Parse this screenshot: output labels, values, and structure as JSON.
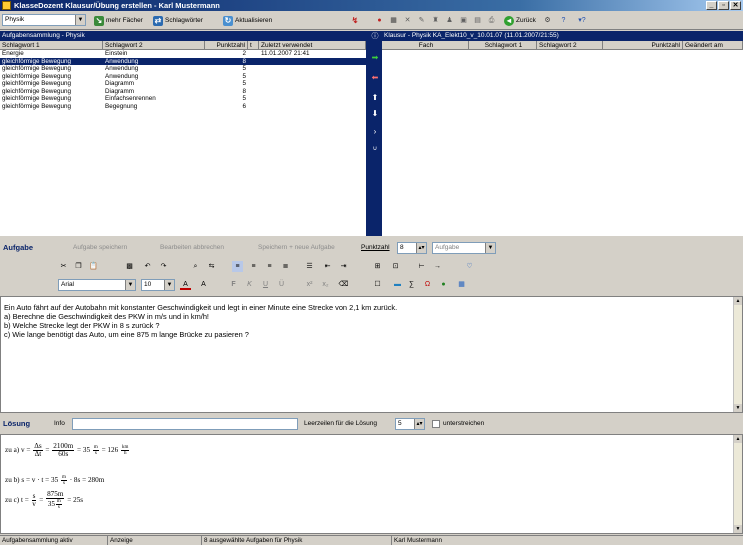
{
  "window": {
    "title": "KlasseDozent Klausur/Übung erstellen - Karl Mustermann",
    "min": "_",
    "max": "▫",
    "close": "✕"
  },
  "toolbar_left": {
    "subject": "Physik",
    "more_subjects": "mehr Fächer",
    "keywords": "Schlagwörter",
    "refresh": "Aktualisieren"
  },
  "toolbar_right": {
    "back": "Zurück",
    "help_mark": "?",
    "search_mark": "▾?"
  },
  "left_panel": {
    "header": "Aufgabensammlung - Physik",
    "columns": [
      "Schlagwort 1",
      "Schlagwort 2",
      "Punktzahl",
      "t",
      "Zuletzt verwendet"
    ],
    "rows": [
      [
        "Energie",
        "Einstein",
        "2",
        "",
        "11.01.2007 21:41"
      ],
      [
        "gleichförmige Bewegung",
        "Anwendung",
        "8",
        "",
        ""
      ],
      [
        "gleichförmige Bewegung",
        "Anwendung",
        "5",
        "",
        ""
      ],
      [
        "gleichförmige Bewegung",
        "Anwendung",
        "5",
        "",
        ""
      ],
      [
        "gleichförmige Bewegung",
        "Diagramm",
        "5",
        "",
        ""
      ],
      [
        "gleichförmige Bewegung",
        "Diagramm",
        "8",
        "",
        ""
      ],
      [
        "gleichförmige Bewegung",
        "Einfachsenrennen",
        "5",
        "",
        ""
      ],
      [
        "gleichförmige Bewegung",
        "Begegnung",
        "6",
        "",
        ""
      ]
    ],
    "selected_row": 1
  },
  "right_panel": {
    "header": "Klausur - Physik KA_Elekt10_v_10.01.07 (11.01.2007/21:55)",
    "columns": [
      "Fach",
      "Schlagwort 1",
      "Schlagwort 2",
      "Punktzahl",
      "Geändert am"
    ]
  },
  "task_bar": {
    "title": "Aufgabe",
    "save": "Aufgabe speichern",
    "cancel_edit": "Bearbeiten abbrechen",
    "save_new": "Speichern + neue Aufgabe",
    "points_label": "Punktzahl",
    "points_value": "8",
    "type_value": "Aufgabe"
  },
  "format_bar": {
    "font": "Arial",
    "size": "10",
    "bold": "F",
    "italic": "K",
    "underline": "U",
    "strike": "Ü"
  },
  "task_text": [
    "Ein Auto fährt auf der Autobahn mit konstanter Geschwindigkeit und legt in einer Minute eine Strecke von 2,1 km zurück.",
    "a) Berechne die Geschwindigkeit des PKW in m/s und in km/h!",
    "b) Welche Strecke legt der PKW in 8 s zurück ?",
    "c) Wie lange benötigt das Auto, um eine 875 m lange Brücke zu pasieren ?"
  ],
  "solution_bar": {
    "title": "Lösung",
    "info_label": "Info",
    "lines_label": "Leerzeilen für die Lösung",
    "lines_value": "5",
    "underline_label": "unterstreichen"
  },
  "solution": {
    "a": {
      "prefix": "zu a) v =",
      "f1_n": "Δs",
      "f1_d": "Δt",
      "eq1": "=",
      "f2_n": "2100m",
      "f2_d": "60s",
      "eq2": "= 35",
      "u1_n": "m",
      "u1_d": "s",
      "eq3": "= 126",
      "u2_n": "km",
      "u2_d": "h"
    },
    "b": {
      "text1": "zu b) s = v · t = 35",
      "u_n": "m",
      "u_d": "s",
      "text2": "· 8s = 280m"
    },
    "c": {
      "prefix": "zu c) t =",
      "f1_n": "s",
      "f1_d": "v",
      "eq1": "=",
      "f2_n": "875m",
      "f2_top_unit": "",
      "f2_d": "35",
      "u_n": "m",
      "u_d": "s",
      "eq2": "= 25s"
    }
  },
  "statusbar": [
    "Aufgabensammlung aktiv",
    "Anzeige",
    "8 ausgewählte Aufgaben für Physik",
    "Karl Mustermann"
  ]
}
